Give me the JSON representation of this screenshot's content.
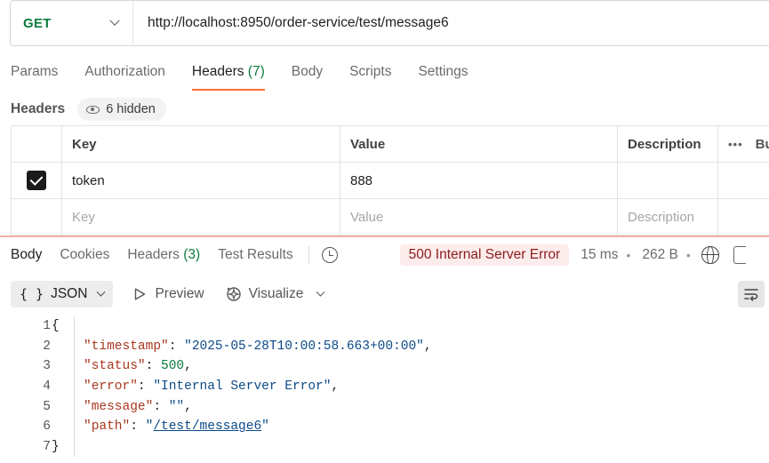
{
  "request": {
    "method": "GET",
    "url": "http://localhost:8950/order-service/test/message6"
  },
  "request_tabs": [
    {
      "label": "Params",
      "count": ""
    },
    {
      "label": "Authorization",
      "count": ""
    },
    {
      "label": "Headers",
      "count": "(7)",
      "active": true
    },
    {
      "label": "Body",
      "count": ""
    },
    {
      "label": "Scripts",
      "count": ""
    },
    {
      "label": "Settings",
      "count": ""
    }
  ],
  "headers_section": {
    "title": "Headers",
    "hidden_label": "6 hidden",
    "columns": [
      "Key",
      "Value",
      "Description",
      "Bu"
    ],
    "rows": [
      {
        "checked": true,
        "key": "token",
        "value": "888",
        "description": ""
      }
    ],
    "placeholders": {
      "key": "Key",
      "value": "Value",
      "description": "Description"
    }
  },
  "response_tabs": [
    {
      "label": "Body",
      "active": true
    },
    {
      "label": "Cookies"
    },
    {
      "label": "Headers",
      "count": "(3)"
    },
    {
      "label": "Test Results"
    }
  ],
  "response_meta": {
    "status": "500 Internal Server Error",
    "time": "15 ms",
    "size": "262 B",
    "status_color": "#8b1c1c"
  },
  "view": {
    "format": "JSON",
    "preview_label": "Preview",
    "visualize_label": "Visualize"
  },
  "response_body": {
    "line_numbers": [
      "1",
      "2",
      "3",
      "4",
      "5",
      "6",
      "7"
    ],
    "timestamp_key": "\"timestamp\"",
    "timestamp_value": "\"2025-05-28T10:00:58.663+00:00\"",
    "status_key": "\"status\"",
    "status_value": "500",
    "error_key": "\"error\"",
    "error_value": "\"Internal Server Error\"",
    "message_key": "\"message\"",
    "message_value": "\"\"",
    "path_key": "\"path\"",
    "path_value": "/test/message6",
    "open_brace": "{",
    "close_brace": "}"
  },
  "icons": {
    "method_dropdown": "chevron-down-icon",
    "hidden_toggle": "eye-icon",
    "history": "history-icon",
    "network": "globe-icon",
    "preview": "play-icon",
    "visualize": "visualize-icon",
    "wrap": "wrap-lines-icon"
  }
}
